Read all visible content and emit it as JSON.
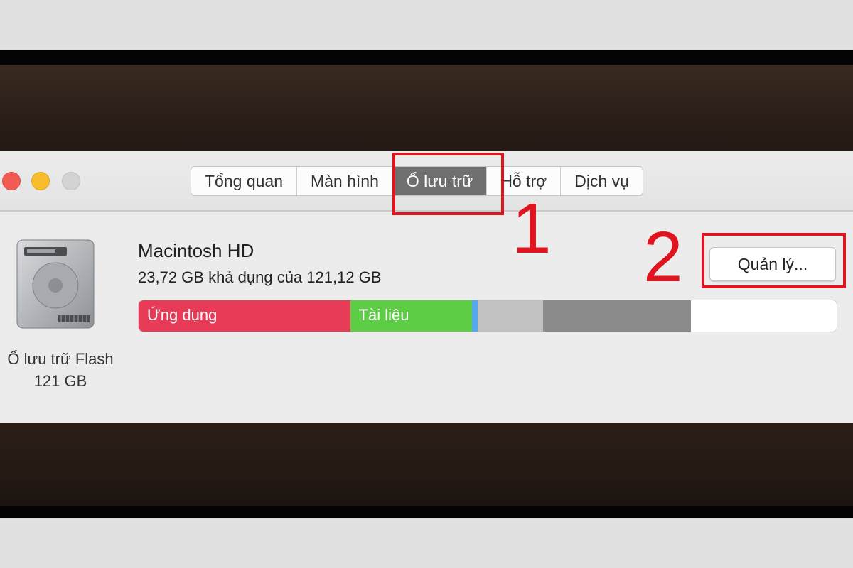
{
  "tabs": [
    {
      "label": "Tổng quan",
      "active": false
    },
    {
      "label": "Màn hình",
      "active": false
    },
    {
      "label": "Ổ lưu trữ",
      "active": true
    },
    {
      "label": "Hỗ trợ",
      "active": false
    },
    {
      "label": "Dịch vụ",
      "active": false
    }
  ],
  "annotations": {
    "step1": "1",
    "step2": "2",
    "color": "#e0141f"
  },
  "disk": {
    "icon": "hard-drive-icon",
    "label_line1": "Ổ lưu trữ Flash",
    "label_line2": "121 GB",
    "name": "Macintosh HD",
    "available": "23,72 GB khả dụng của 121,12 GB"
  },
  "manage_button": "Quản lý...",
  "storage": {
    "total_gb": 121.12,
    "available_gb": 23.72,
    "segments": [
      {
        "label": "Ứng dụng",
        "fraction": 0.303,
        "color": "#e83b58"
      },
      {
        "label": "Tài liệu",
        "fraction": 0.175,
        "color": "#5ccd45"
      },
      {
        "label": "",
        "fraction": 0.0075,
        "color": "#56a8f0"
      },
      {
        "label": "",
        "fraction": 0.094,
        "color": "#c2c2c2"
      },
      {
        "label": "",
        "fraction": 0.212,
        "color": "#8b8b8b"
      },
      {
        "label": "",
        "fraction": 0.2085,
        "color": "#ffffff"
      }
    ]
  },
  "window_controls": [
    "close-button",
    "minimize-button",
    "zoom-button"
  ]
}
